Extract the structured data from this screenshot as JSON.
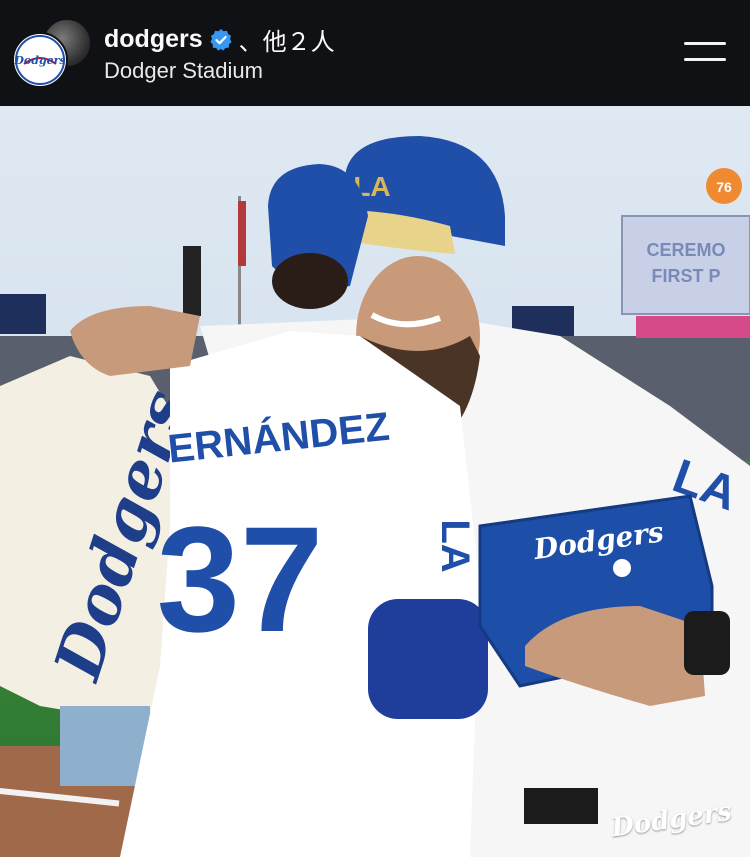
{
  "post_header": {
    "account_name": "dodgers",
    "verified": true,
    "collaborators_text": "、他２人",
    "location": "Dodger Stadium",
    "menu_icon": "hamburger-menu-icon"
  },
  "avatar": {
    "logo_text": "Dodgers"
  },
  "photo": {
    "jersey_name": "ERNÁNDEZ",
    "jersey_number": "37",
    "cap_logo": "LA",
    "sleeve_logo": "LA",
    "held_jersey_text": "Dodgers",
    "box_text": "Dodgers",
    "scoreboard_text": "CEREMO FIRST P",
    "sign_76": "76",
    "watermark": "Dodgers"
  },
  "colors": {
    "header_bg": "#101114",
    "dodger_blue": "#1f4fa8",
    "verified_blue": "#3897f0"
  }
}
